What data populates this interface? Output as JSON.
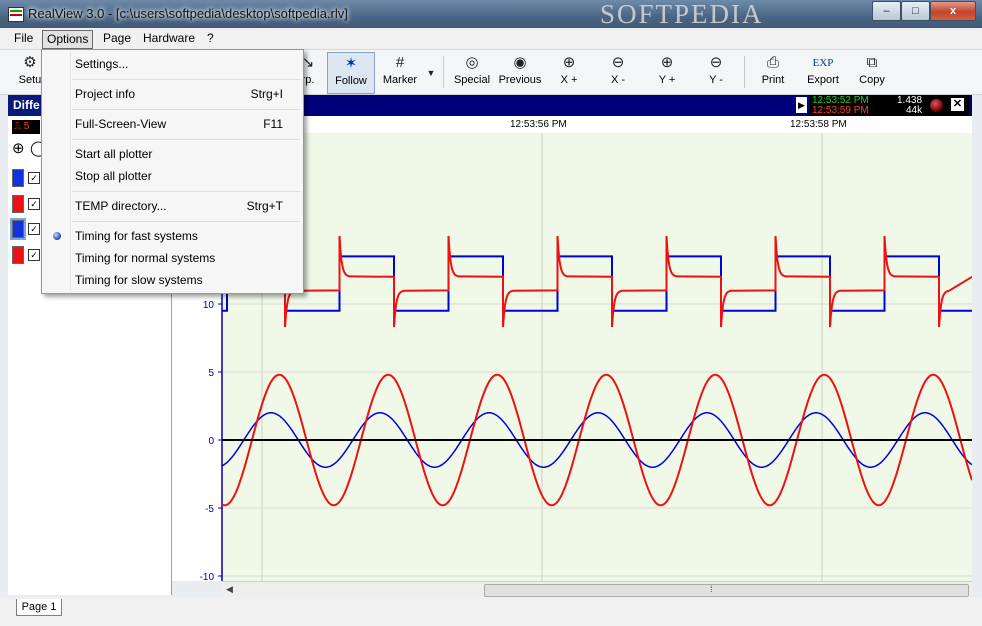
{
  "window": {
    "title": "RealView 3.0 - [c:\\users\\softpedia\\desktop\\softpedia.rlv]",
    "watermark": "SOFTPEDIA",
    "minimize": "–",
    "maximize": "□",
    "close": "x"
  },
  "menubar": [
    "File",
    "Options",
    "Page",
    "Hardware",
    "?"
  ],
  "toolbar": {
    "setup": "Setu",
    "zoom_part": "rp.",
    "follow": "Follow",
    "marker": "Marker",
    "special": "Special",
    "previous": "Previous",
    "x_plus": "X +",
    "x_minus": "X -",
    "y_plus": "Y +",
    "y_minus": "Y -",
    "print": "Print",
    "export": "Export",
    "export_icon_text": "EXP",
    "copy": "Copy"
  },
  "left_panel": {
    "header": "Diffe",
    "counter": "5"
  },
  "plot_header": {
    "time_green": "12:53:52 PM",
    "time_red": "12:53:59 PM",
    "value_top": "1.438",
    "value_bottom": "44k"
  },
  "time_axis": [
    "12:53:56 PM",
    "12:53:58 PM"
  ],
  "menu_options": {
    "items": [
      {
        "label": "Settings...",
        "accel": ""
      },
      {
        "label": "Project info",
        "accel": "Strg+I"
      },
      {
        "label": "Full-Screen-View",
        "accel": "F11"
      },
      {
        "label": "Start all plotter",
        "accel": ""
      },
      {
        "label": "Stop all plotter",
        "accel": ""
      },
      {
        "label": "TEMP directory...",
        "accel": "Strg+T"
      },
      {
        "label": "Timing for fast systems",
        "accel": ""
      },
      {
        "label": "Timing for normal systems",
        "accel": ""
      },
      {
        "label": "Timing for slow systems",
        "accel": ""
      }
    ],
    "selected_timing": "Timing for fast systems"
  },
  "page_tabs": [
    "Page 1"
  ],
  "colors": {
    "series_blue": "#0000dd",
    "series_red": "#ee1111",
    "plot_bg": "#f0f8e8",
    "header_navy": "#00007b"
  },
  "chart_data": {
    "type": "line",
    "xlabel": "",
    "ylabel": "",
    "y_ticks": [
      "10",
      "5",
      "0",
      "-5",
      "-10"
    ],
    "ylim": [
      -10,
      15
    ],
    "grid": true,
    "series": [
      {
        "color": "#0000dd",
        "kind": "square",
        "low": 9.5,
        "high": 13.5,
        "period_s": 0.8
      },
      {
        "color": "#ee1111",
        "kind": "square-with-spikes",
        "low": 11,
        "high": 12,
        "spike_max": 15,
        "spike_min": 8.3,
        "period_s": 0.8
      },
      {
        "color": "#0000dd",
        "kind": "sine",
        "amplitude": 2,
        "offset": 0,
        "period_s": 0.8
      },
      {
        "color": "#ee1111",
        "kind": "sine",
        "amplitude": 4.8,
        "offset": 0,
        "period_s": 0.8
      },
      {
        "color": "#000000",
        "kind": "constant",
        "value": 0
      }
    ]
  }
}
